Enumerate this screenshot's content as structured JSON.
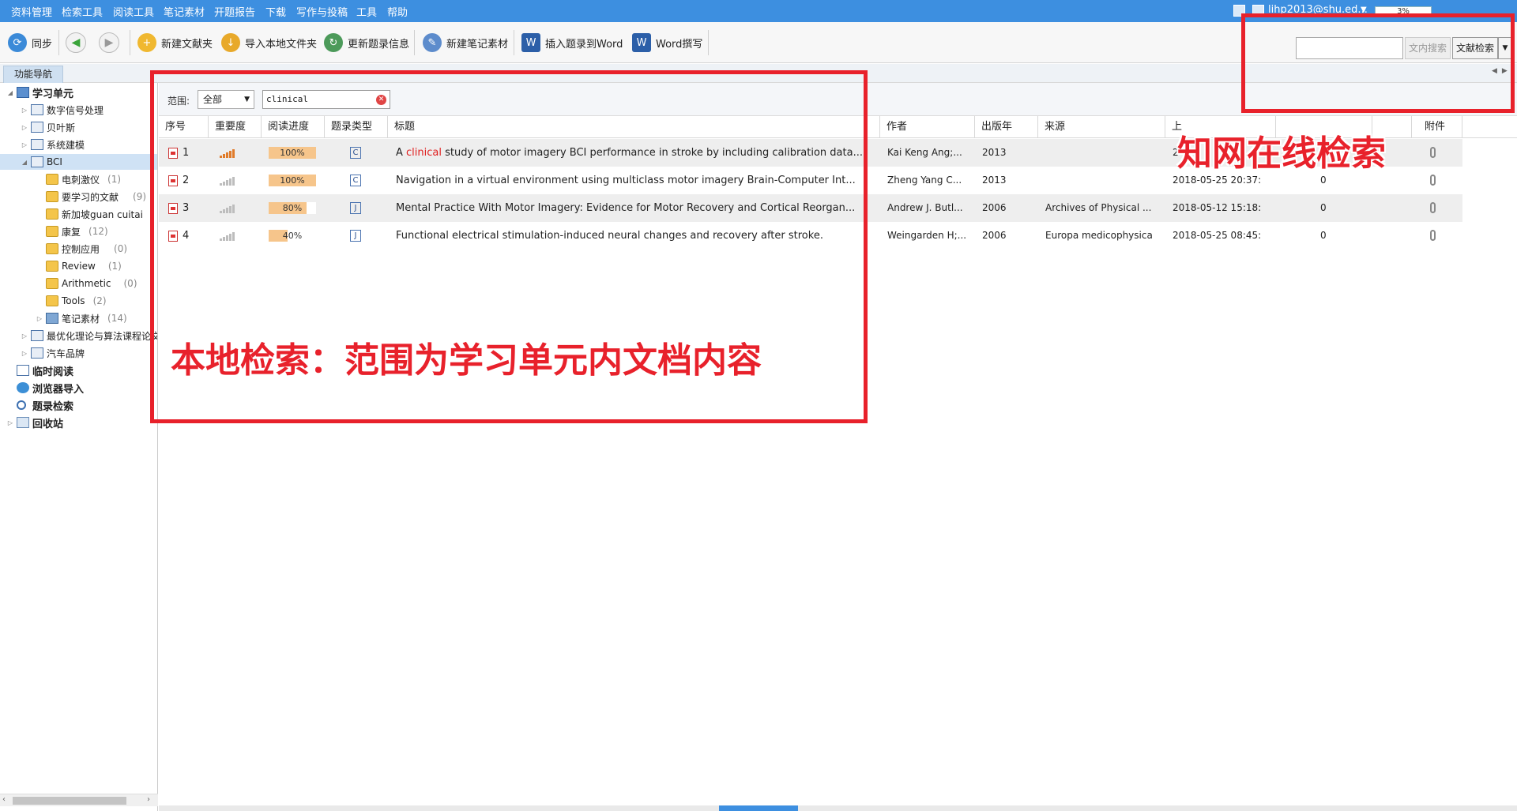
{
  "menu": {
    "items": [
      "资料管理",
      "检索工具",
      "阅读工具",
      "笔记素材",
      "开题报告",
      "下载",
      "写作与投稿",
      "工具",
      "帮助"
    ],
    "account": "lihp2013@shu.ed...",
    "progress": "3%"
  },
  "toolbar": {
    "sync": "同步",
    "new_folder": "新建文献夹",
    "import_local": "导入本地文件夹",
    "update_info": "更新题录信息",
    "new_note": "新建笔记素材",
    "insert_word": "插入题录到Word",
    "word_write": "Word撰写",
    "inner_search": "文内搜索",
    "lit_search": "文献检索"
  },
  "subbar": {
    "nav_tab": "功能导航"
  },
  "sidebar": {
    "items": [
      {
        "label": "学习单元",
        "count": ""
      },
      {
        "label": "数字信号处理",
        "count": ""
      },
      {
        "label": "贝叶斯",
        "count": ""
      },
      {
        "label": "系统建模",
        "count": ""
      },
      {
        "label": "BCI",
        "count": ""
      },
      {
        "label": "电刺激仪",
        "count": "(1)"
      },
      {
        "label": "要学习的文献",
        "count": "(9)"
      },
      {
        "label": "新加坡guan cuitai",
        "count": ""
      },
      {
        "label": "康复",
        "count": "(12)"
      },
      {
        "label": "控制应用",
        "count": "(0)"
      },
      {
        "label": "Review",
        "count": "(1)"
      },
      {
        "label": "Arithmetic",
        "count": "(0)"
      },
      {
        "label": "Tools",
        "count": "(2)"
      },
      {
        "label": "笔记素材",
        "count": "(14)"
      },
      {
        "label": "最优化理论与算法课程论文",
        "count": ""
      },
      {
        "label": "汽车品牌",
        "count": ""
      },
      {
        "label": "临时阅读",
        "count": ""
      },
      {
        "label": "浏览器导入",
        "count": ""
      },
      {
        "label": "题录检索",
        "count": ""
      },
      {
        "label": "回收站",
        "count": ""
      }
    ]
  },
  "filter": {
    "scope_label": "范围:",
    "scope_value": "全部",
    "search_value": "clinical"
  },
  "table": {
    "headers": [
      "序号",
      "重要度",
      "阅读进度",
      "题录类型",
      "标题",
      "作者",
      "出版年",
      "来源",
      "上",
      "",
      "附件"
    ],
    "rows": [
      {
        "num": "1",
        "importance": 5,
        "progress": 1.0,
        "progress_label": "100%",
        "type": "C",
        "title_pre": "A ",
        "title_hl": "clinical",
        "title_post": " study of motor imagery BCI performance in stroke by including calibration data...",
        "author": "Kai Keng Ang;...",
        "year": "2013",
        "source": "",
        "date": "2",
        "count": ""
      },
      {
        "num": "2",
        "importance": 1,
        "progress": 1.0,
        "progress_label": "100%",
        "type": "C",
        "title_pre": "Navigation in a virtual environment using multiclass motor imagery Brain-Computer Int...",
        "title_hl": "",
        "title_post": "",
        "author": "Zheng Yang C...",
        "year": "2013",
        "source": "",
        "date": "2018-05-25 20:37:",
        "count": "0"
      },
      {
        "num": "3",
        "importance": 1,
        "progress": 0.8,
        "progress_label": "80%",
        "type": "J",
        "title_pre": "Mental Practice With Motor Imagery: Evidence for Motor Recovery and Cortical Reorgan...",
        "title_hl": "",
        "title_post": "",
        "author": "Andrew J. Butl...",
        "year": "2006",
        "source": "Archives of Physical ...",
        "date": "2018-05-12 15:18:",
        "count": "0"
      },
      {
        "num": "4",
        "importance": 1,
        "progress": 0.4,
        "progress_label": "40%",
        "type": "J",
        "title_pre": "Functional electrical stimulation-induced neural changes and recovery after stroke.",
        "title_hl": "",
        "title_post": "",
        "author": "Weingarden H;...",
        "year": "2006",
        "source": "Europa medicophysica",
        "date": "2018-05-25 08:45:",
        "count": "0"
      }
    ]
  },
  "annotations": {
    "online": "知网在线检索",
    "local": "本地检索：范围为学习单元内文档内容"
  },
  "colors": {
    "accent": "#3d8fe0",
    "annotation": "#e8212b",
    "highlight": "#e02020"
  }
}
